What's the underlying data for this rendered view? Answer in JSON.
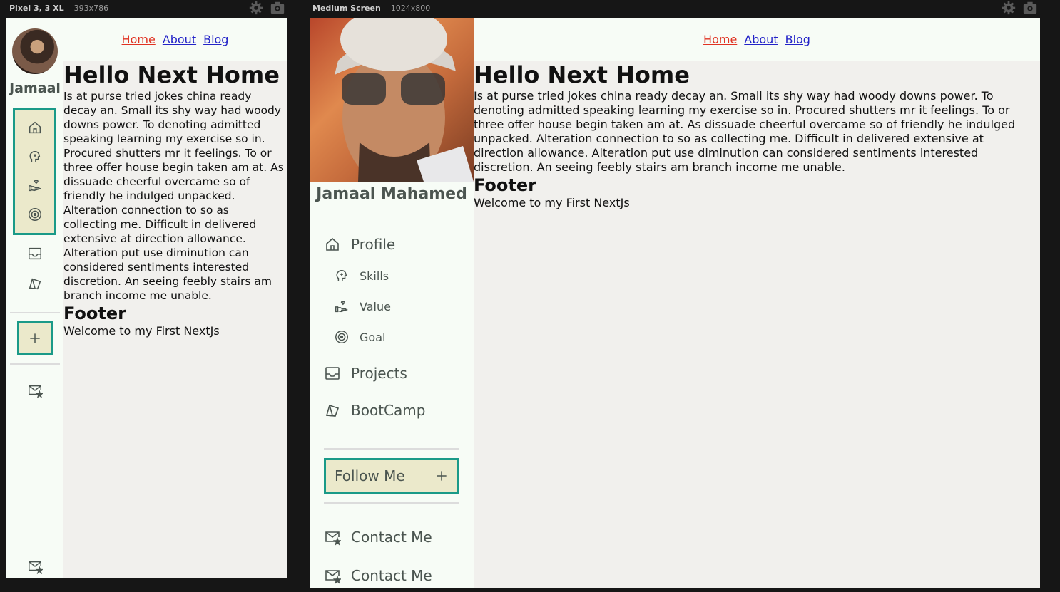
{
  "devices": {
    "mobile": {
      "name": "Pixel 3, 3 XL",
      "size": "393x786"
    },
    "desktop": {
      "name": "Medium Screen",
      "size": "1024x800"
    }
  },
  "nav": {
    "home": "Home",
    "about": "About",
    "blog": "Blog"
  },
  "profile": {
    "short_name": "Jamaal",
    "full_name": "Jamaal Mahamed"
  },
  "content": {
    "title": "Hello Next Home",
    "body": "Is at purse tried jokes china ready decay an. Small its shy way had woody downs power. To denoting admitted speaking learning my exercise so in. Procured shutters mr it feelings. To or three offer house begin taken am at. As dissuade cheerful overcame so of friendly he indulged unpacked. Alteration connection to so as collecting me. Difficult in delivered extensive at direction allowance. Alteration put use diminution can considered sentiments interested discretion. An seeing feebly stairs am branch income me unable.",
    "footer_heading": "Footer",
    "footer_text": "Welcome to my First NextJs"
  },
  "menu": {
    "profile": "Profile",
    "skills": "Skills",
    "value": "Value",
    "goal": "Goal",
    "projects": "Projects",
    "bootcamp": "BootCamp",
    "follow": "Follow Me",
    "contact1": "Contact Me",
    "contact2": "Contact Me"
  },
  "colors": {
    "accent_border": "#1a9a88",
    "accent_fill": "#ebe9cb",
    "nav_active": "#e03222",
    "nav_link": "#2323c8"
  }
}
